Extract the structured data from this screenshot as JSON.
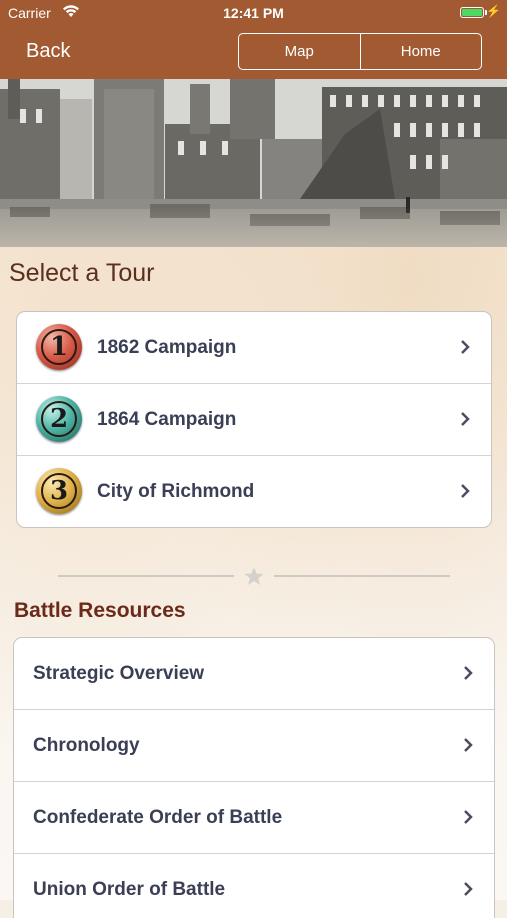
{
  "status": {
    "carrier": "Carrier",
    "time": "12:41 PM"
  },
  "nav": {
    "back_label": "Back",
    "segments": [
      "Map",
      "Home"
    ]
  },
  "tours": {
    "title": "Select a Tour",
    "items": [
      {
        "number": "1",
        "label": "1862 Campaign",
        "color": "#a8362a"
      },
      {
        "number": "2",
        "label": "1864 Campaign",
        "color": "#2d8a7e"
      },
      {
        "number": "3",
        "label": "City of Richmond",
        "color": "#c8951f"
      }
    ]
  },
  "resources": {
    "title": "Battle Resources",
    "items": [
      {
        "label": "Strategic Overview"
      },
      {
        "label": "Chronology"
      },
      {
        "label": "Confederate Order of Battle"
      },
      {
        "label": "Union Order of Battle"
      }
    ]
  },
  "colors": {
    "nav_bar": "#a25a33",
    "heading": "#5a2f1d",
    "section_heading": "#6b2a1a",
    "row_text": "#3a3f55"
  }
}
